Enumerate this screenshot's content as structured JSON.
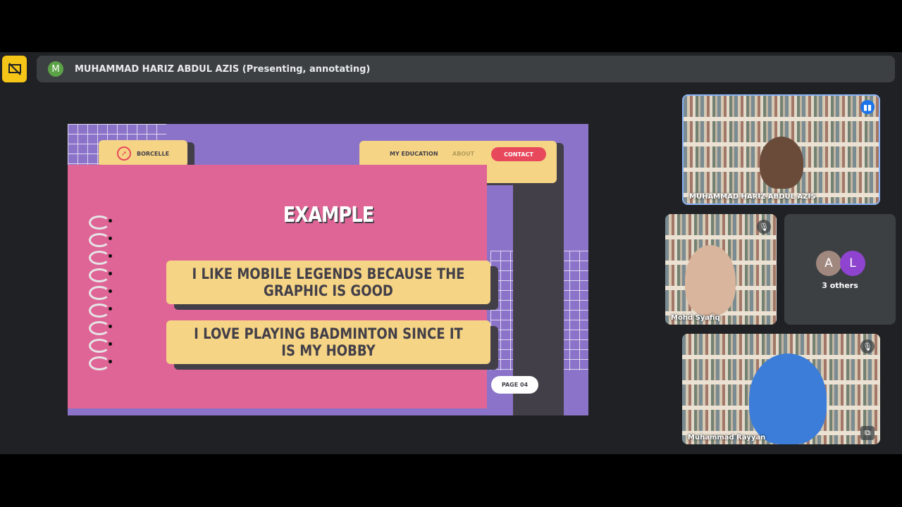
{
  "presentation_bar": {
    "presenter_initial": "M",
    "presenter_text": "MUHAMMAD HARIZ ABDUL AZIS (Presenting, annotating)"
  },
  "slide": {
    "brand": "BORCELLE",
    "nav": [
      "MY EDUCATION",
      "ABOUT",
      "CONTACT"
    ],
    "title": "EXAMPLE",
    "boxes": [
      "I LIKE MOBILE LEGENDS BECAUSE THE GRAPHIC IS GOOD",
      "I LOVE PLAYING BADMINTON SINCE IT IS MY HOBBY"
    ],
    "page": "PAGE 04"
  },
  "participants": [
    {
      "name": "MUHAMMAD HARIZ ABDUL AZIS",
      "speaking": true
    },
    {
      "name": "Mohd Syafiq",
      "muted": true
    },
    {
      "name": "Muhammad Rayyan",
      "muted": true
    }
  ],
  "others": {
    "avatars": [
      "A",
      "L"
    ],
    "label": "3 others"
  },
  "colors": {
    "accent": "#f5c518",
    "slide_purple": "#8a73c8",
    "slide_pink": "#df6597",
    "slide_yellow": "#f5d485",
    "contact_red": "#e8485c"
  }
}
